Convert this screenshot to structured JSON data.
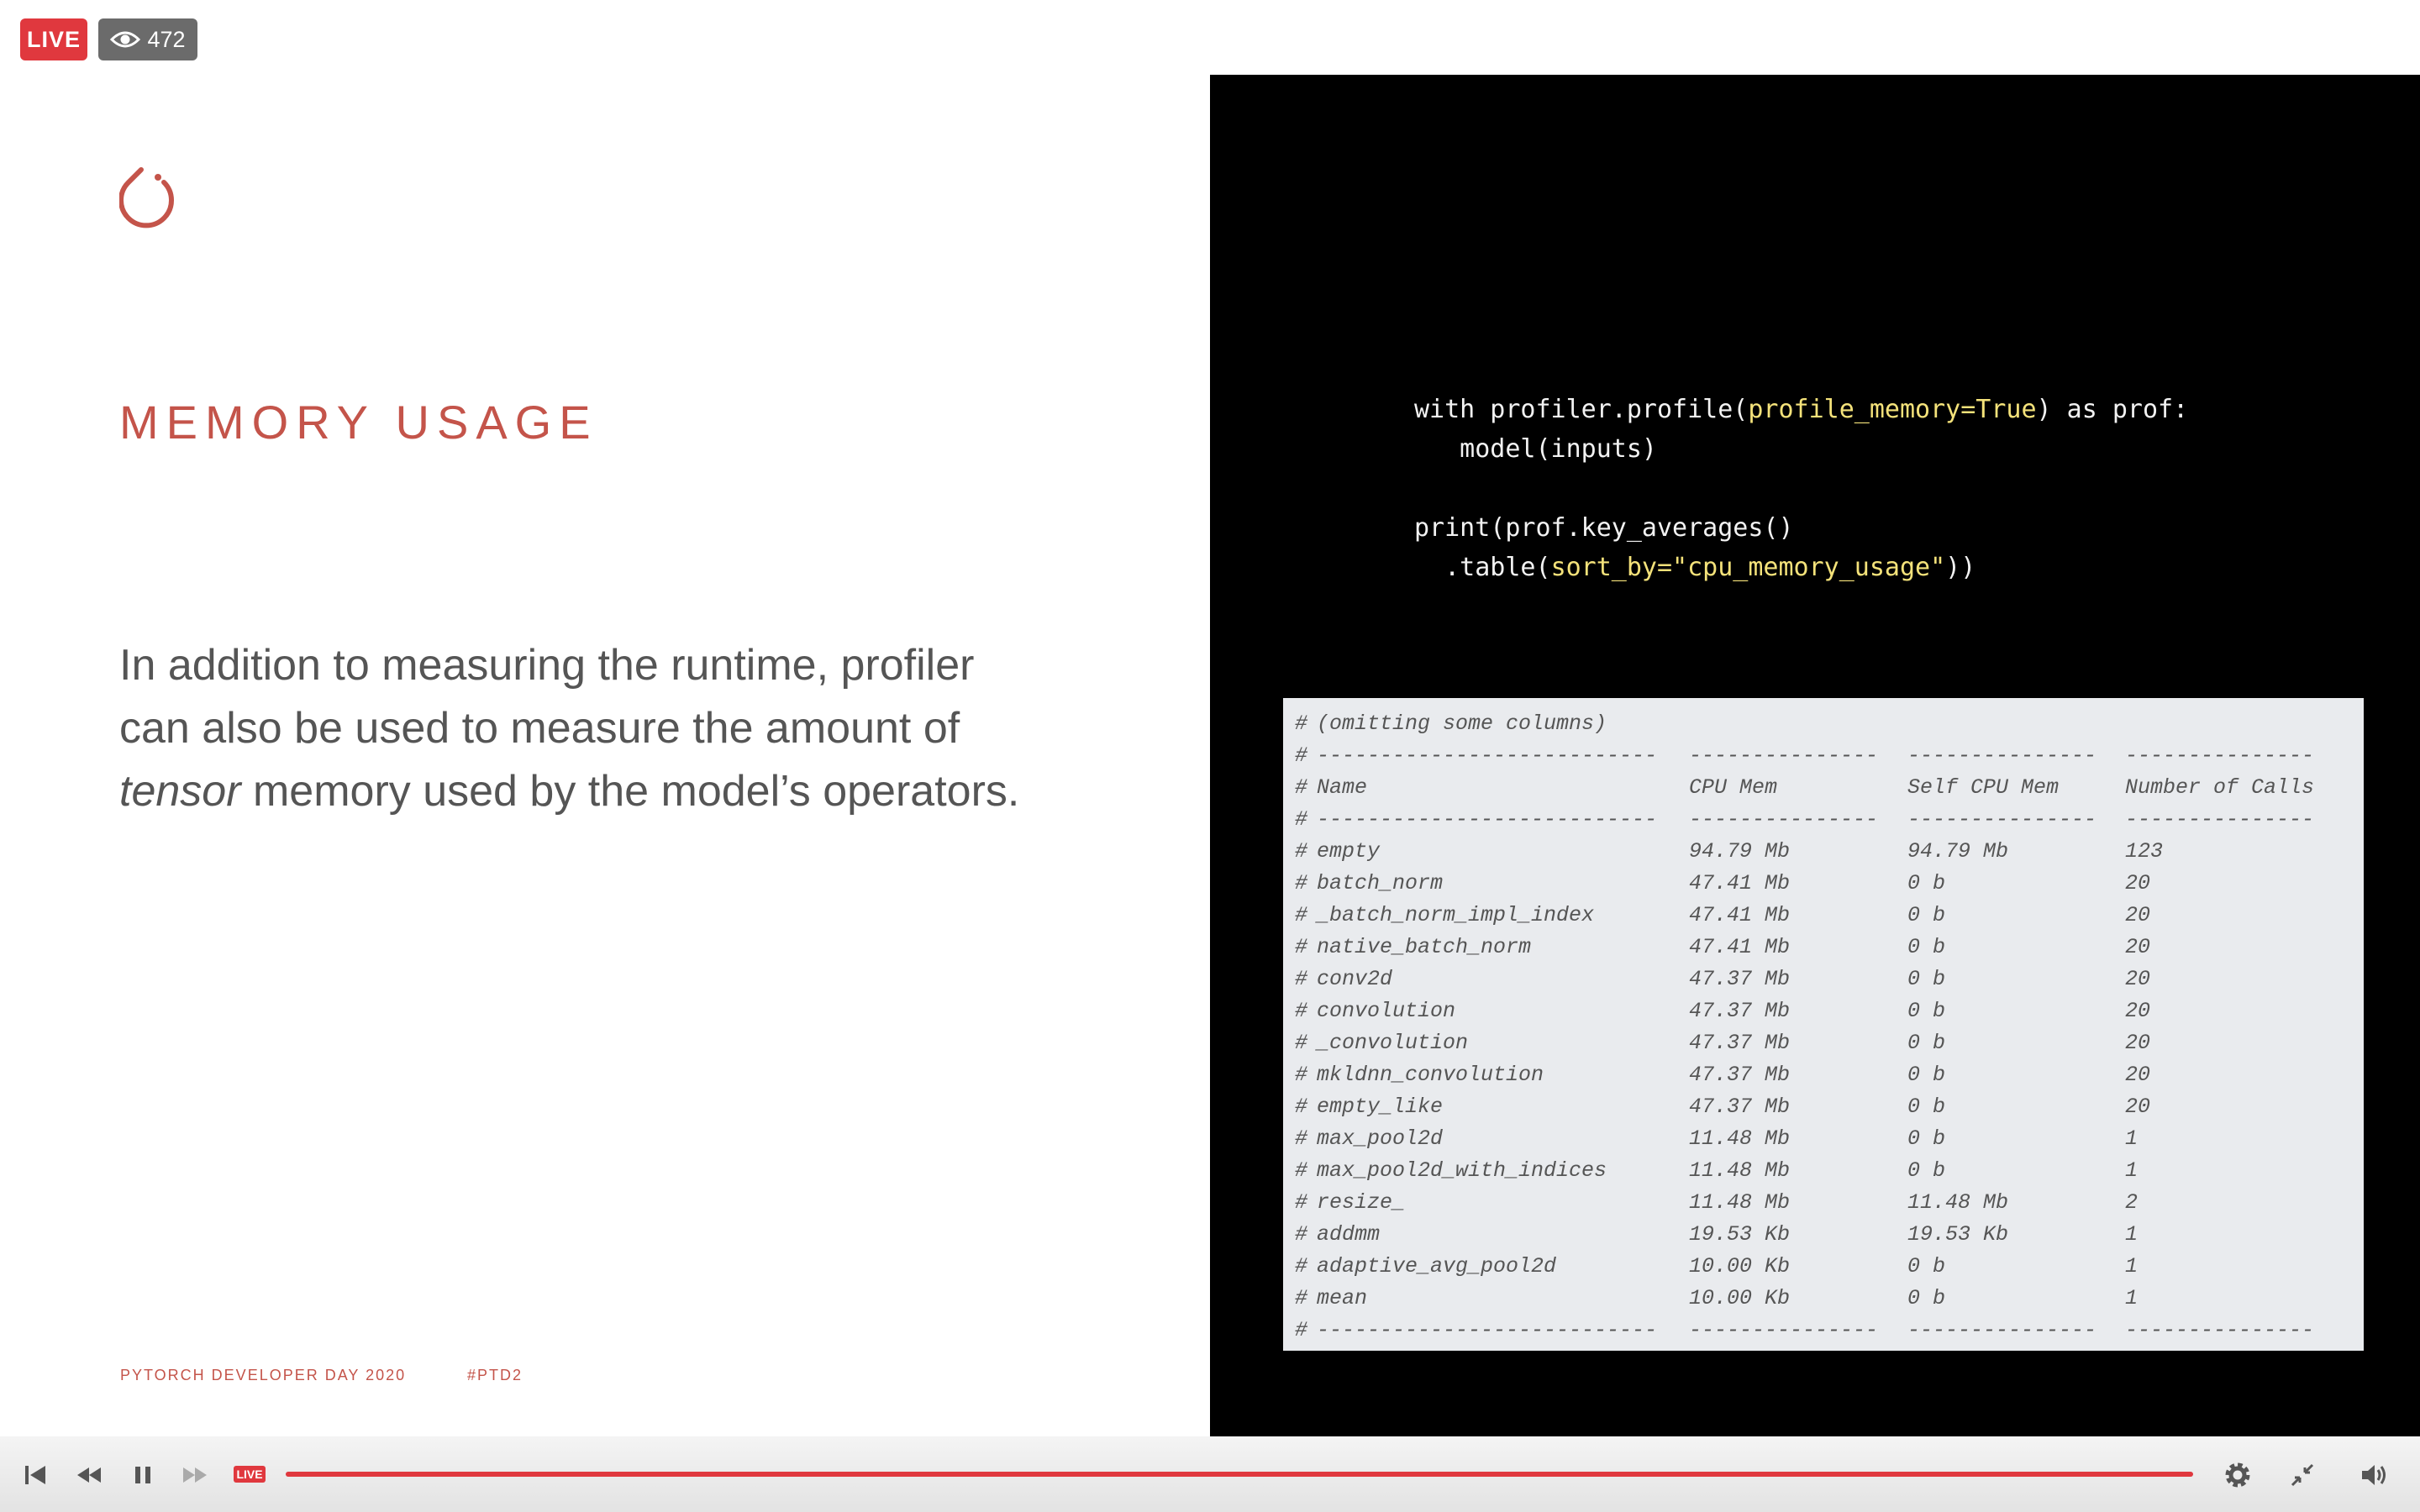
{
  "player": {
    "live_label": "LIVE",
    "viewer_count": "472",
    "live_small_label": "LIVE",
    "progress_fraction": 1.0,
    "accent_color": "#e0383e",
    "icons": [
      "skip-back-icon",
      "rewind-icon",
      "pause-icon",
      "fast-forward-icon",
      "gear-icon",
      "collapse-icon",
      "volume-icon"
    ]
  },
  "slide": {
    "title": "MEMORY USAGE",
    "body_line1": "In addition to measuring the runtime, profiler",
    "body_line2": "can also be used to measure the amount of",
    "body_line3_italic": "tensor",
    "body_line3_rest": " memory used by the model’s operators.",
    "footer_event": "PYTORCH DEVELOPER DAY 2020",
    "footer_hashtag": "#PTD2",
    "accent_color": "#c4544a"
  },
  "code": {
    "line1_a": "with profiler.profile(",
    "line1_hl": "profile_memory=True",
    "line1_b": ") as prof:",
    "line2": "   model(inputs)",
    "line3": "",
    "line4": "print(prof.key_averages()",
    "line5_a": "  .table(",
    "line5_hl": "sort_by=\"cpu_memory_usage\"",
    "line5_b": "))"
  },
  "table": {
    "comment": "(omitting some columns)",
    "separator": [
      "---------------------------",
      "---------------",
      "---------------",
      "---------------"
    ],
    "headers": [
      "Name",
      "CPU Mem",
      "Self CPU Mem",
      "Number of Calls"
    ],
    "rows": [
      [
        "empty",
        "94.79 Mb",
        "94.79 Mb",
        "123"
      ],
      [
        "batch_norm",
        "47.41 Mb",
        "0 b",
        "20"
      ],
      [
        "_batch_norm_impl_index",
        "47.41 Mb",
        "0 b",
        "20"
      ],
      [
        "native_batch_norm",
        "47.41 Mb",
        "0 b",
        "20"
      ],
      [
        "conv2d",
        "47.37 Mb",
        "0 b",
        "20"
      ],
      [
        "convolution",
        "47.37 Mb",
        "0 b",
        "20"
      ],
      [
        "_convolution",
        "47.37 Mb",
        "0 b",
        "20"
      ],
      [
        "mkldnn_convolution",
        "47.37 Mb",
        "0 b",
        "20"
      ],
      [
        "empty_like",
        "47.37 Mb",
        "0 b",
        "20"
      ],
      [
        "max_pool2d",
        "11.48 Mb",
        "0 b",
        "1"
      ],
      [
        "max_pool2d_with_indices",
        "11.48 Mb",
        "0 b",
        "1"
      ],
      [
        "resize_",
        "11.48 Mb",
        "11.48 Mb",
        "2"
      ],
      [
        "addmm",
        "19.53 Kb",
        "19.53 Kb",
        "1"
      ],
      [
        "adaptive_avg_pool2d",
        "10.00 Kb",
        "0 b",
        "1"
      ],
      [
        "mean",
        "10.00 Kb",
        "0 b",
        "1"
      ]
    ]
  }
}
